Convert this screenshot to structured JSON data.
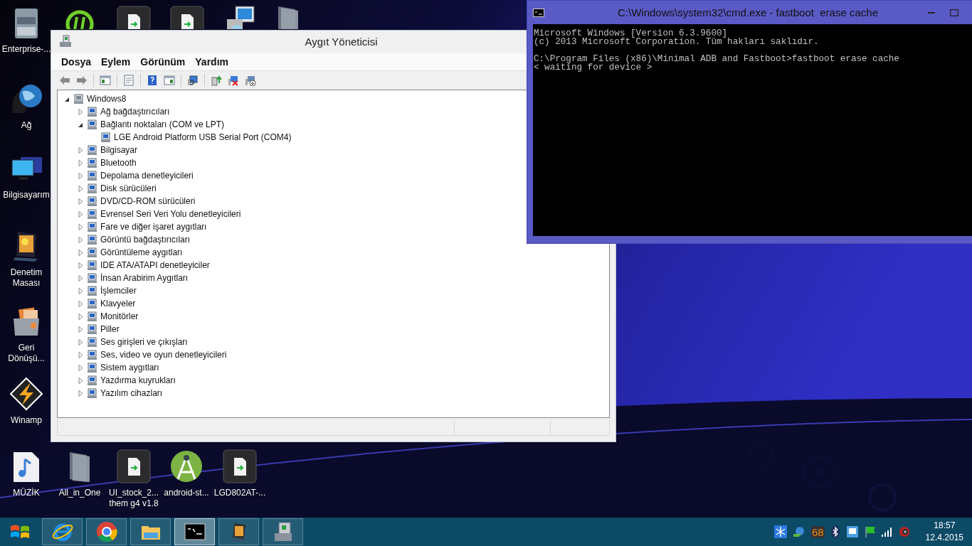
{
  "desktop": {
    "icons": [
      {
        "kind": "server",
        "label": "Enterprise-..."
      },
      {
        "kind": "ring"
      },
      {
        "kind": "file"
      },
      {
        "kind": "file"
      },
      {
        "kind": "installer"
      },
      {
        "kind": "folder"
      },
      {
        "kind": "globe",
        "label": "Ağ"
      },
      {
        "kind": "monitors",
        "label": "Bilgisayarım"
      },
      {
        "kind": "panel",
        "label": "Denetim\nMasası"
      },
      {
        "kind": "bin",
        "label": "Geri\nDönüşü..."
      },
      {
        "kind": "bolt",
        "label": "Winamp"
      },
      {
        "kind": "music",
        "label": "MÜZİK"
      },
      {
        "kind": "folder",
        "label": "All_in_One"
      },
      {
        "kind": "file",
        "label": "UI_stock_2...\nthem g4 v1.8"
      },
      {
        "kind": "compass",
        "label": "android-st..."
      },
      {
        "kind": "file",
        "label": "LGD802AT-..."
      }
    ]
  },
  "device_manager": {
    "title": "Aygıt Yöneticisi",
    "menu": [
      "Dosya",
      "Eylem",
      "Görünüm",
      "Yardım"
    ],
    "tree": {
      "label": "Windows8",
      "expanded": true,
      "children": [
        {
          "label": "Ağ bağdaştırıcıları",
          "expanded": false
        },
        {
          "label": "Bağlantı noktaları (COM ve LPT)",
          "expanded": true,
          "children": [
            {
              "label": "LGE Android Platform USB Serial Port (COM4)"
            }
          ]
        },
        {
          "label": "Bilgisayar",
          "expanded": false
        },
        {
          "label": "Bluetooth",
          "expanded": false
        },
        {
          "label": "Depolama denetleyicileri",
          "expanded": false
        },
        {
          "label": "Disk sürücüleri",
          "expanded": false
        },
        {
          "label": "DVD/CD-ROM sürücüleri",
          "expanded": false
        },
        {
          "label": "Evrensel Seri Veri Yolu denetleyicileri",
          "expanded": false
        },
        {
          "label": "Fare ve diğer işaret aygıtları",
          "expanded": false
        },
        {
          "label": "Görüntü bağdaştırıcıları",
          "expanded": false
        },
        {
          "label": "Görüntüleme aygıtları",
          "expanded": false
        },
        {
          "label": "IDE ATA/ATAPI denetleyiciler",
          "expanded": false
        },
        {
          "label": "İnsan Arabirim Aygıtları",
          "expanded": false
        },
        {
          "label": "İşlemciler",
          "expanded": false
        },
        {
          "label": "Klavyeler",
          "expanded": false
        },
        {
          "label": "Monitörler",
          "expanded": false
        },
        {
          "label": "Piller",
          "expanded": false
        },
        {
          "label": "Ses girişleri ve çıkışları",
          "expanded": false
        },
        {
          "label": "Ses, video ve oyun denetleyicileri",
          "expanded": false
        },
        {
          "label": "Sistem aygıtları",
          "expanded": false
        },
        {
          "label": "Yazdırma kuyrukları",
          "expanded": false
        },
        {
          "label": "Yazılım cihazları",
          "expanded": false
        }
      ]
    }
  },
  "console": {
    "title": "C:\\Windows\\system32\\cmd.exe - fastboot  erase cache",
    "paragraphs": [
      [
        "Microsoft Windows [Version 6.3.9600]",
        "(c) 2013 Microsoft Corporation. Tüm hakları saklıdır."
      ],
      [
        "C:\\Program Files (x86)\\Minimal ADB and Fastboot>fastboot erase cache",
        "< waiting for device >"
      ]
    ]
  },
  "taskbar": {
    "items": [
      {
        "kind": "start",
        "selected": false
      },
      {
        "kind": "browser-e",
        "selected": false
      },
      {
        "kind": "browser-ring",
        "selected": false
      },
      {
        "kind": "explorer",
        "selected": false
      },
      {
        "kind": "terminal",
        "selected": true
      },
      {
        "kind": "panel",
        "selected": false
      },
      {
        "kind": "device",
        "selected": false
      }
    ],
    "tray": {
      "badge": "68",
      "time": "18:57",
      "date": "12.4.2015"
    }
  }
}
